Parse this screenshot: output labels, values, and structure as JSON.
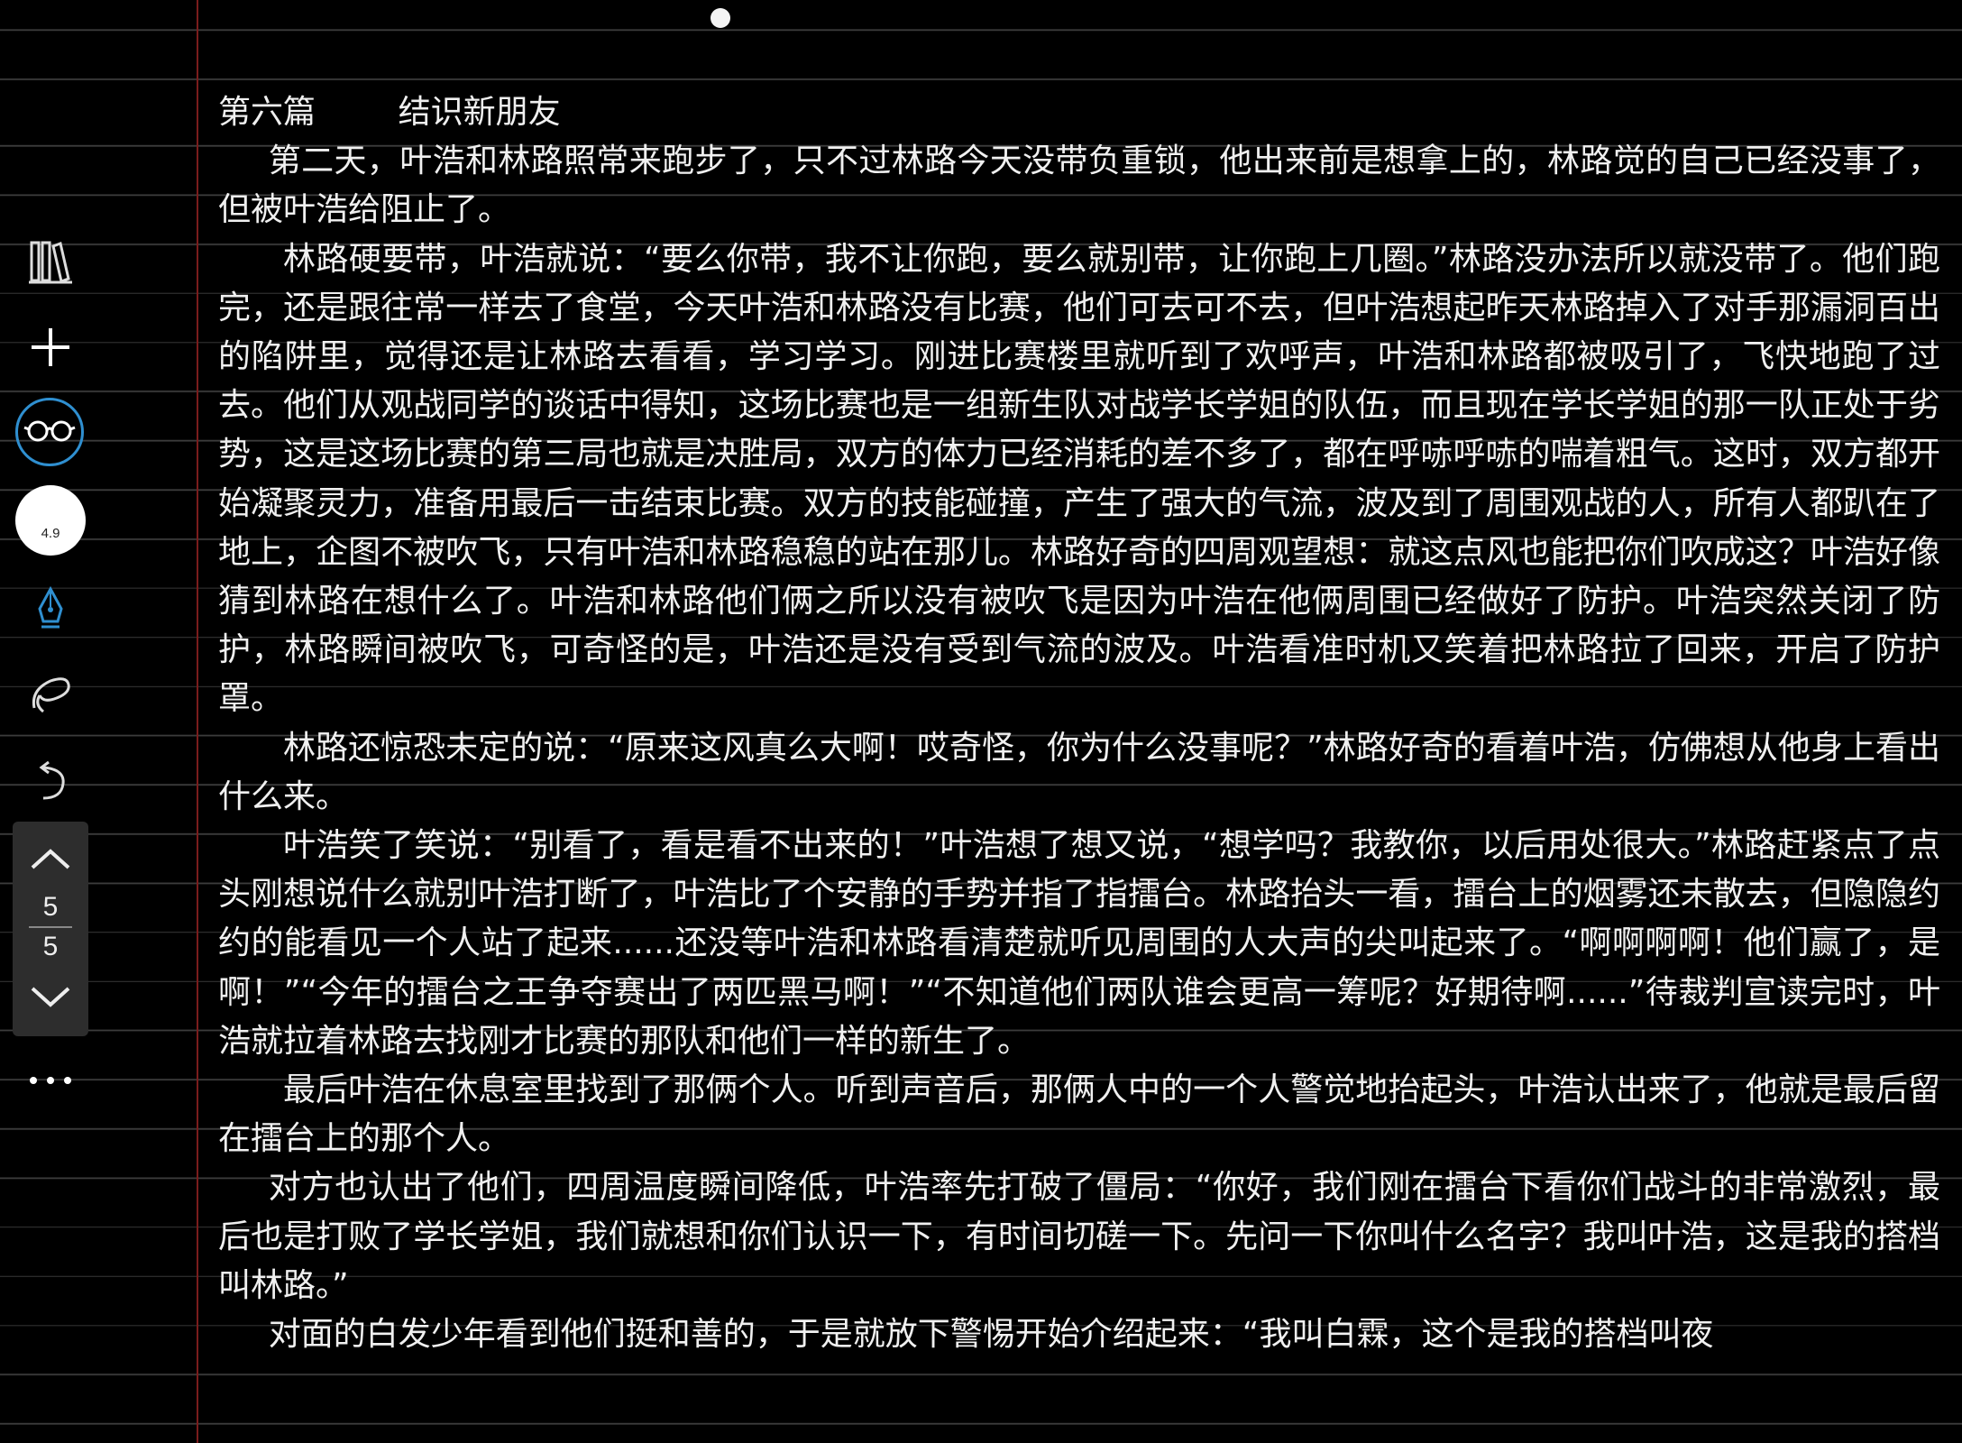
{
  "toolbar": {
    "zoom_level": "4.9",
    "icons": [
      "library-icon",
      "add-icon",
      "reading-glasses-icon",
      "zoom-indicator",
      "pen-icon",
      "lasso-icon",
      "undo-icon",
      "more-icon"
    ]
  },
  "pager": {
    "current": "5",
    "total": "5"
  },
  "document": {
    "chapter_label": "第六篇",
    "chapter_title": "结识新朋友",
    "paragraphs": [
      "第二天，叶浩和林路照常来跑步了，只不过林路今天没带负重锁，他出来前是想拿上的，林路觉的自己已经没事了，但被叶浩给阻止了。",
      "林路硬要带，叶浩就说：“要么你带，我不让你跑，要么就别带，让你跑上几圈。”林路没办法所以就没带了。他们跑完，还是跟往常一样去了食堂，今天叶浩和林路没有比赛，他们可去可不去，但叶浩想起昨天林路掉入了对手那漏洞百出的陷阱里，觉得还是让林路去看看，学习学习。刚进比赛楼里就听到了欢呼声，叶浩和林路都被吸引了，飞快地跑了过去。他们从观战同学的谈话中得知，这场比赛也是一组新生队对战学长学姐的队伍，而且现在学长学姐的那一队正处于劣势，这是这场比赛的第三局也就是决胜局，双方的体力已经消耗的差不多了，都在呼哧呼哧的喘着粗气。这时，双方都开始凝聚灵力，准备用最后一击结束比赛。双方的技能碰撞，产生了强大的气流，波及到了周围观战的人，所有人都趴在了地上，企图不被吹飞，只有叶浩和林路稳稳的站在那儿。林路好奇的四周观望想：就这点风也能把你们吹成这？叶浩好像猜到林路在想什么了。叶浩和林路他们俩之所以没有被吹飞是因为叶浩在他俩周围已经做好了防护。叶浩突然关闭了防护，林路瞬间被吹飞，可奇怪的是，叶浩还是没有受到气流的波及。叶浩看准时机又笑着把林路拉了回来，开启了防护罩。",
      "林路还惊恐未定的说：“原来这风真么大啊！哎奇怪，你为什么没事呢？”林路好奇的看着叶浩，仿佛想从他身上看出什么来。",
      "叶浩笑了笑说：“别看了，看是看不出来的！”叶浩想了想又说，“想学吗？我教你，以后用处很大。”林路赶紧点了点头刚想说什么就别叶浩打断了，叶浩比了个安静的手势并指了指擂台。林路抬头一看，擂台上的烟雾还未散去，但隐隐约约的能看见一个人站了起来......还没等叶浩和林路看清楚就听见周围的人大声的尖叫起来了。“啊啊啊啊！他们赢了，是啊！”“今年的擂台之王争夺赛出了两匹黑马啊！”“不知道他们两队谁会更高一筹呢？好期待啊......”待裁判宣读完时，叶浩就拉着林路去找刚才比赛的那队和他们一样的新生了。",
      "最后叶浩在休息室里找到了那俩个人。听到声音后，那俩人中的一个人警觉地抬起头，叶浩认出来了，他就是最后留在擂台上的那个人。",
      "对方也认出了他们，四周温度瞬间降低，叶浩率先打破了僵局：“你好，我们刚在擂台下看你们战斗的非常激烈，最后也是打败了学长学姐，我们就想和你们认识一下，有时间切磋一下。先问一下你叫什么名字？我叫叶浩，这是我的搭档叫林路。”",
      "对面的白发少年看到他们挺和善的，于是就放下警惕开始介绍起来：“我叫白霖，这个是我的搭档叫夜"
    ]
  }
}
